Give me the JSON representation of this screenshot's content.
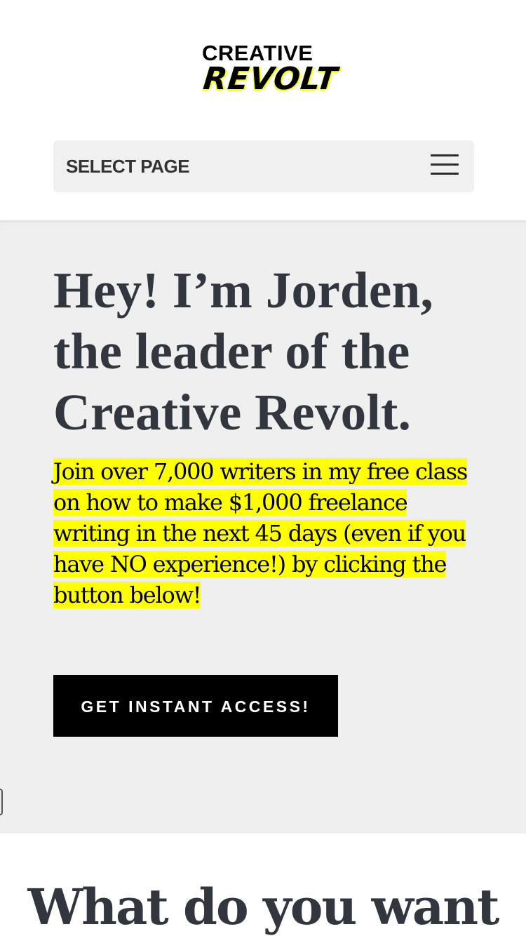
{
  "header": {
    "logo": {
      "line1": "CREATIVE",
      "line2": "REVOLT",
      "accent_color": "#f4ff00"
    },
    "nav": {
      "label": "SELECT PAGE",
      "menu_icon": "hamburger-menu-icon"
    }
  },
  "hero": {
    "title": "Hey! I’m Jorden, the leader of the Creative Revolt.",
    "subtitle": "Join over 7,000 writers in my free class on how to make $1,000 freelance writing in the next 45 days (even if you have NO experience!) by clicking the button below!",
    "highlight_color": "#ffff00",
    "cta_label": "GET INSTANT ACCESS!",
    "background": "#efefef"
  },
  "section2": {
    "title": "What do you want"
  },
  "colors": {
    "heading": "#31363f",
    "button_bg": "#000000",
    "button_text": "#ffffff"
  }
}
